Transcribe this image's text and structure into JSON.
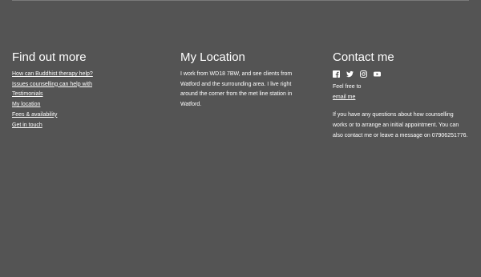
{
  "find_out_more": {
    "heading": "Find out more",
    "links": [
      "How can Buddhist therapy help?",
      "Issues counselling can help with",
      "Testimonials",
      "My location",
      "Fees & availability",
      "Get in touch"
    ]
  },
  "location": {
    "heading": "My Location",
    "text": "I work from WD18 7BW, and see clients from Watford and the surrounding area. I live right around the corner from the met line station in Watford."
  },
  "contact": {
    "heading": "Contact me",
    "social_icons": [
      "facebook-icon",
      "twitter-icon",
      "instagram-icon",
      "youtube-icon"
    ],
    "feel_free": "Feel free to",
    "email_link": "email me",
    "text": "If you have any questions about how counselling works or to arrange an initial appointment. You can also contact me or leave a message on 07906251776."
  },
  "colors": {
    "background": "#545454",
    "text": "#ffffff",
    "rule": "#7a7a7a"
  }
}
